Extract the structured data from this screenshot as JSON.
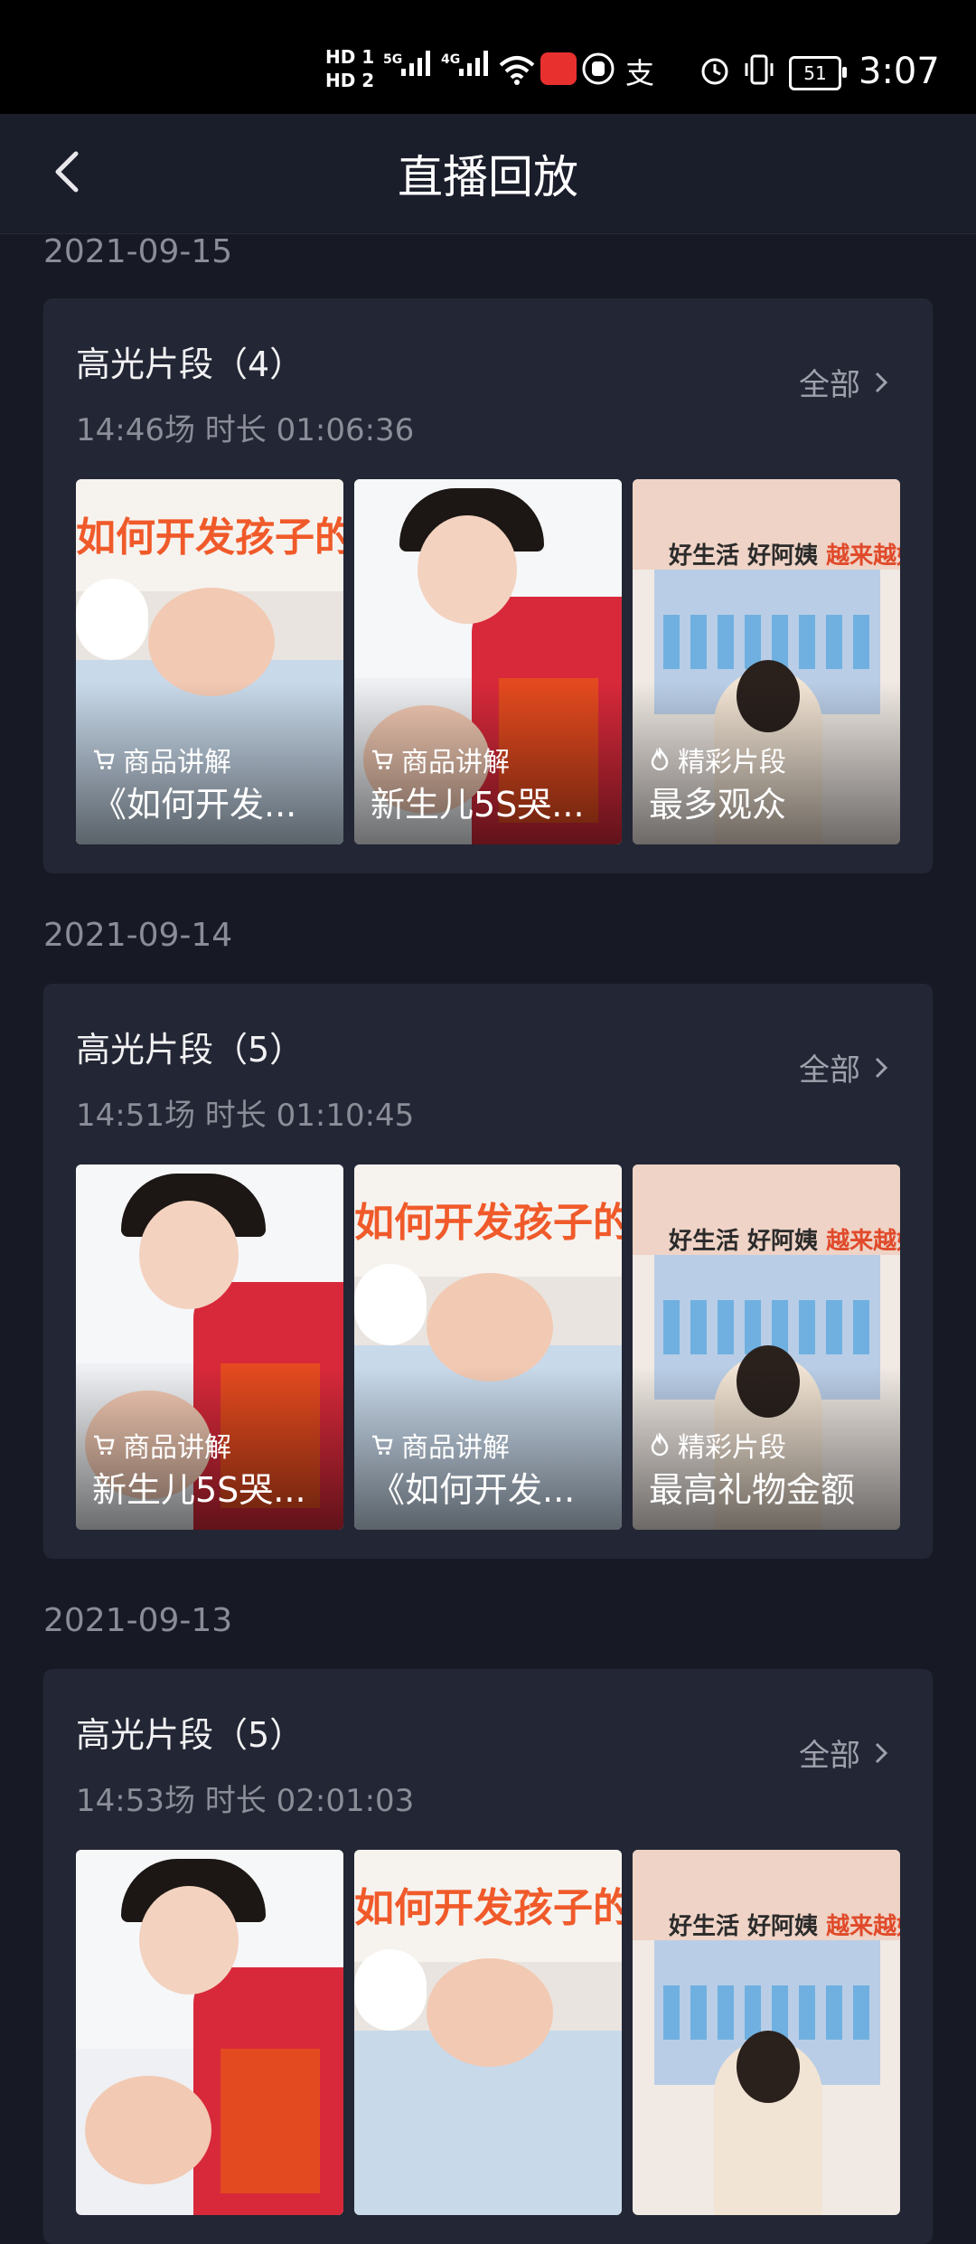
{
  "status_bar": {
    "hd1": "HD 1",
    "hd2": "HD 2",
    "net1": "5G",
    "net2": "4G",
    "battery": "51",
    "time": "3:07"
  },
  "header": {
    "title": "直播回放",
    "back_icon": "chevron-left-icon"
  },
  "sections": [
    {
      "date": "2021-09-15",
      "title": "高光片段（4）",
      "meta": "14:46场 时长 01:06:36",
      "all_label": "全部",
      "thumbs": [
        {
          "tag": "商品讲解",
          "tag_icon": "cart-icon",
          "caption": "《如何开发...",
          "banner": "如何开发孩子的大"
        },
        {
          "tag": "商品讲解",
          "tag_icon": "cart-icon",
          "caption": "新生儿5S哭..."
        },
        {
          "tag": "精彩片段",
          "tag_icon": "flame-icon",
          "caption": "最多观众",
          "slogan1": "好生活 好阿姨",
          "slogan2": "越来越好"
        }
      ]
    },
    {
      "date": "2021-09-14",
      "title": "高光片段（5）",
      "meta": "14:51场 时长 01:10:45",
      "all_label": "全部",
      "thumbs": [
        {
          "tag": "商品讲解",
          "tag_icon": "cart-icon",
          "caption": "新生儿5S哭..."
        },
        {
          "tag": "商品讲解",
          "tag_icon": "cart-icon",
          "caption": "《如何开发...",
          "banner": "如何开发孩子的大"
        },
        {
          "tag": "精彩片段",
          "tag_icon": "flame-icon",
          "caption": "最高礼物金额",
          "slogan1": "好生活 好阿姨",
          "slogan2": "越来越好"
        }
      ]
    },
    {
      "date": "2021-09-13",
      "title": "高光片段（5）",
      "meta": "14:53场 时长 02:01:03",
      "all_label": "全部",
      "thumbs": [
        {
          "tag": "",
          "tag_icon": "",
          "caption": ""
        },
        {
          "tag": "",
          "tag_icon": "",
          "caption": "",
          "banner": "如何开发孩子的大"
        },
        {
          "tag": "",
          "tag_icon": "",
          "caption": "",
          "slogan1": "好生活 好阿姨",
          "slogan2": "越来越好"
        }
      ]
    }
  ]
}
